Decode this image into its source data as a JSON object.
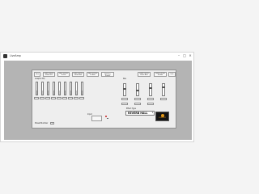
{
  "window": {
    "title": "LiveAmp"
  },
  "controls": {
    "btn_a": "Gen",
    "btn_b": "Load Preset\nFrom File",
    "btn_c": "Save Preset\nTo File",
    "btn_d": "Load Preset\nFrom Box",
    "btn_e": "Save Preset\nTo Box",
    "btn_f": "Restore Factory\nPreset",
    "btn_g": "Load Preset\nFrom Box",
    "btn_h": "Save Preset\nTo Box",
    "btn_i": "Info",
    "eq_label": "Graphic EQ",
    "fader_values": [
      0.32,
      0.32,
      0.32,
      0.32,
      0.32,
      0.32,
      0.32,
      0.32,
      0.32
    ],
    "fader_fields": [
      "",
      "",
      "",
      "",
      "",
      "",
      "",
      "",
      ""
    ],
    "preset_label": "Preset Number",
    "preset_value": "1",
    "mid_label": "Input",
    "reverb_label": "Effect Type",
    "reverb_value": "REVERB HALL",
    "logo_text": "SOUNDSHOP",
    "colors": {
      "background": "#b4b4b4",
      "panel": "#eeeeee",
      "accent": "#e59a1a",
      "indicator": "#c41e1e"
    }
  }
}
